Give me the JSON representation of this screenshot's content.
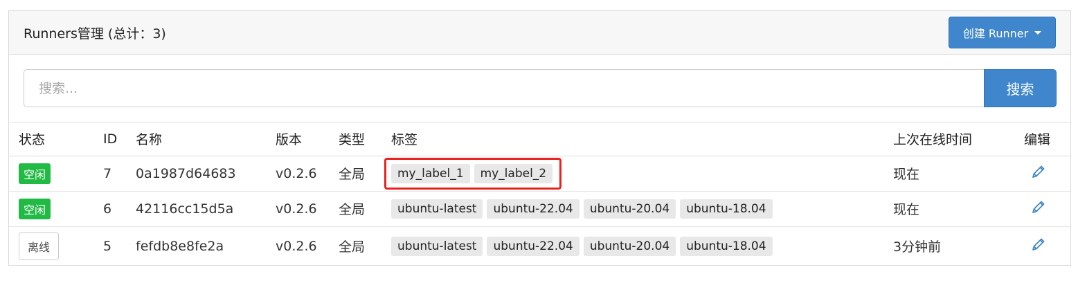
{
  "header": {
    "title": "Runners管理 (总计：3)",
    "create_button": "创建 Runner"
  },
  "search": {
    "placeholder": "搜索...",
    "value": "",
    "button": "搜索"
  },
  "table": {
    "columns": [
      "状态",
      "ID",
      "名称",
      "版本",
      "类型",
      "标签",
      "上次在线时间",
      "编辑"
    ],
    "rows": [
      {
        "status": "空闲",
        "status_kind": "idle",
        "id": "7",
        "name": "0a1987d64683",
        "version": "v0.2.6",
        "type": "全局",
        "labels": [
          "my_label_1",
          "my_label_2"
        ],
        "labels_highlighted": true,
        "last_online": "现在"
      },
      {
        "status": "空闲",
        "status_kind": "idle",
        "id": "6",
        "name": "42116cc15d5a",
        "version": "v0.2.6",
        "type": "全局",
        "labels": [
          "ubuntu-latest",
          "ubuntu-22.04",
          "ubuntu-20.04",
          "ubuntu-18.04"
        ],
        "labels_highlighted": false,
        "last_online": "现在"
      },
      {
        "status": "离线",
        "status_kind": "offline",
        "id": "5",
        "name": "fefdb8e8fe2a",
        "version": "v0.2.6",
        "type": "全局",
        "labels": [
          "ubuntu-latest",
          "ubuntu-22.04",
          "ubuntu-20.04",
          "ubuntu-18.04"
        ],
        "labels_highlighted": false,
        "last_online": "3分钟前"
      }
    ]
  },
  "icons": {
    "edit": "pencil-icon",
    "dropdown": "caret-down-icon"
  },
  "colors": {
    "primary": "#3f86cc",
    "idle_badge": "#21ba45",
    "highlight_border": "#e8231f",
    "edit_icon": "#3f86cc"
  }
}
